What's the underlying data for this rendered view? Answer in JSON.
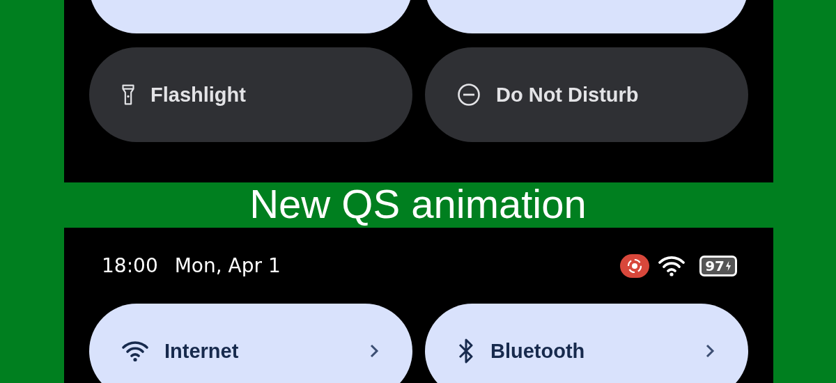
{
  "top_panel": {
    "tiles": [
      {
        "kind": "blank",
        "on": true,
        "has_details": false
      },
      {
        "kind": "blank",
        "on": true,
        "has_details": false
      },
      {
        "kind": "flashlight",
        "label": "Flashlight",
        "on": false,
        "has_details": false
      },
      {
        "kind": "dnd",
        "label": "Do Not Disturb",
        "on": false,
        "has_details": false
      }
    ]
  },
  "caption": "New QS animation",
  "bottom_panel": {
    "status_bar": {
      "time": "18:00",
      "date": "Mon, Apr 1",
      "recording": true,
      "battery": "97",
      "charging": true
    },
    "tiles": [
      {
        "kind": "internet",
        "label": "Internet",
        "on": true,
        "has_details": true
      },
      {
        "kind": "bluetooth",
        "label": "Bluetooth",
        "on": true,
        "has_details": true
      }
    ]
  }
}
